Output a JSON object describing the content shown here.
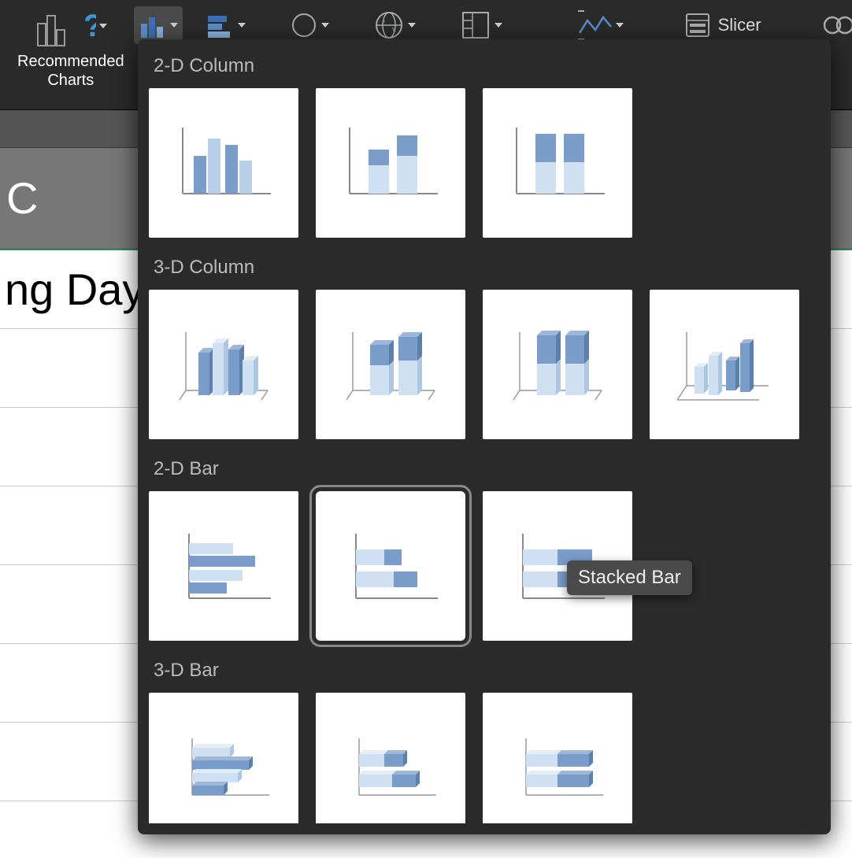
{
  "ribbon": {
    "recommended_charts_label_line1": "Recommended",
    "recommended_charts_label_line2": "Charts",
    "slicer_label": "Slicer"
  },
  "sheet": {
    "column_label": "C",
    "header_cell_text": "ng Days"
  },
  "dropdown": {
    "sections": {
      "col2d": "2-D Column",
      "col3d": "3-D Column",
      "bar2d": "2-D Bar",
      "bar3d": "3-D Bar"
    },
    "tooltip": "Stacked Bar"
  }
}
